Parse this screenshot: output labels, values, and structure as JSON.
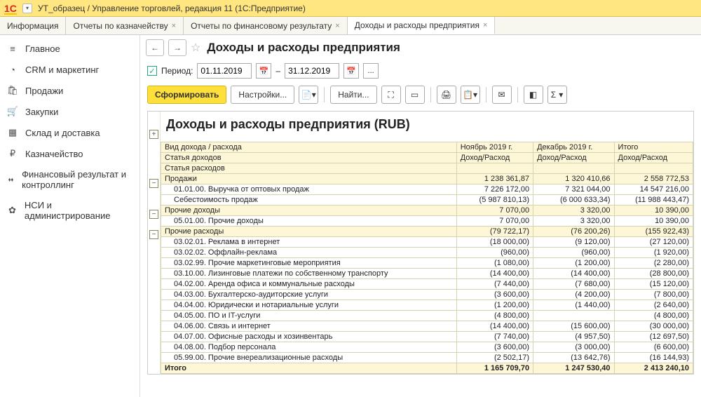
{
  "window": {
    "title": "УТ_образец / Управление торговлей, редакция 11  (1С:Предприятие)"
  },
  "tabs": [
    {
      "label": "Информация",
      "closable": false
    },
    {
      "label": "Отчеты по казначейству",
      "closable": true
    },
    {
      "label": "Отчеты по финансовому результату",
      "closable": true
    },
    {
      "label": "Доходы и расходы предприятия",
      "closable": true,
      "active": true
    }
  ],
  "sidebar": [
    {
      "icon": "≡",
      "label": "Главное"
    },
    {
      "icon": "◔",
      "label": "CRM и маркетинг"
    },
    {
      "icon": "🛍",
      "label": "Продажи"
    },
    {
      "icon": "🛒",
      "label": "Закупки"
    },
    {
      "icon": "▦",
      "label": "Склад и доставка"
    },
    {
      "icon": "₽",
      "label": "Казначейство"
    },
    {
      "icon": "⬪⬪",
      "label": "Финансовый результат и контроллинг"
    },
    {
      "icon": "✿",
      "label": "НСИ и администрирование"
    }
  ],
  "page": {
    "title": "Доходы и расходы предприятия"
  },
  "period": {
    "label": "Период:",
    "from": "01.11.2019",
    "to": "31.12.2019",
    "sep": "–"
  },
  "buttons": {
    "form": "Сформировать",
    "settings": "Настройки...",
    "find": "Найти..."
  },
  "report": {
    "title": "Доходы и расходы предприятия (RUB)",
    "headers": {
      "c0": "Вид дохода / расхода",
      "c0a": "Статья доходов",
      "c0b": "Статья расходов",
      "c1": "Ноябрь 2019 г.",
      "c2": "Декабрь 2019 г.",
      "c3": "Итого",
      "sub": "Доход/Расход"
    },
    "rows": [
      {
        "t": "g",
        "indent": 0,
        "label": "Продажи",
        "v": [
          "1 238 361,87",
          "1 320 410,66",
          "2 558 772,53"
        ]
      },
      {
        "t": "d",
        "indent": 1,
        "label": "01.01.00. Выручка от оптовых продаж",
        "v": [
          "7 226 172,00",
          "7 321 044,00",
          "14 547 216,00"
        ]
      },
      {
        "t": "d",
        "indent": 1,
        "label": "Себестоимость продаж",
        "v": [
          "(5 987 810,13)",
          "(6 000 633,34)",
          "(11 988 443,47)"
        ]
      },
      {
        "t": "g",
        "indent": 0,
        "label": "Прочие доходы",
        "v": [
          "7 070,00",
          "3 320,00",
          "10 390,00"
        ]
      },
      {
        "t": "d",
        "indent": 1,
        "label": "05.01.00. Прочие доходы",
        "v": [
          "7 070,00",
          "3 320,00",
          "10 390,00"
        ]
      },
      {
        "t": "g",
        "indent": 0,
        "label": "Прочие расходы",
        "v": [
          "(79 722,17)",
          "(76 200,26)",
          "(155 922,43)"
        ]
      },
      {
        "t": "d",
        "indent": 1,
        "label": "03.02.01. Реклама в интернет",
        "v": [
          "(18 000,00)",
          "(9 120,00)",
          "(27 120,00)"
        ]
      },
      {
        "t": "d",
        "indent": 1,
        "label": "03.02.02. Оффлайн-реклама",
        "v": [
          "(960,00)",
          "(960,00)",
          "(1 920,00)"
        ]
      },
      {
        "t": "d",
        "indent": 1,
        "label": "03.02.99. Прочие маркетинговые мероприятия",
        "v": [
          "(1 080,00)",
          "(1 200,00)",
          "(2 280,00)"
        ]
      },
      {
        "t": "d",
        "indent": 1,
        "label": "03.10.00. Лизинговые платежи по собственному транспорту",
        "v": [
          "(14 400,00)",
          "(14 400,00)",
          "(28 800,00)"
        ]
      },
      {
        "t": "d",
        "indent": 1,
        "label": "04.02.00. Аренда офиса и коммунальные расходы",
        "v": [
          "(7 440,00)",
          "(7 680,00)",
          "(15 120,00)"
        ]
      },
      {
        "t": "d",
        "indent": 1,
        "label": "04.03.00. Бухгалтерско-аудиторские услуги",
        "v": [
          "(3 600,00)",
          "(4 200,00)",
          "(7 800,00)"
        ]
      },
      {
        "t": "d",
        "indent": 1,
        "label": "04.04.00. Юридически и нотариальные услуги",
        "v": [
          "(1 200,00)",
          "(1 440,00)",
          "(2 640,00)"
        ]
      },
      {
        "t": "d",
        "indent": 1,
        "label": "04.05.00. ПО и IT-услуги",
        "v": [
          "(4 800,00)",
          "",
          "(4 800,00)"
        ]
      },
      {
        "t": "d",
        "indent": 1,
        "label": "04.06.00. Связь и интернет",
        "v": [
          "(14 400,00)",
          "(15 600,00)",
          "(30 000,00)"
        ]
      },
      {
        "t": "d",
        "indent": 1,
        "label": "04.07.00. Офисные расходы и хозинвентарь",
        "v": [
          "(7 740,00)",
          "(4 957,50)",
          "(12 697,50)"
        ]
      },
      {
        "t": "d",
        "indent": 1,
        "label": "04.08.00. Подбор персонала",
        "v": [
          "(3 600,00)",
          "(3 000,00)",
          "(6 600,00)"
        ]
      },
      {
        "t": "d",
        "indent": 1,
        "label": "05.99.00. Прочие внереализационные расходы",
        "v": [
          "(2 502,17)",
          "(13 642,76)",
          "(16 144,93)"
        ]
      },
      {
        "t": "t",
        "indent": 0,
        "label": "Итого",
        "v": [
          "1 165 709,70",
          "1 247 530,40",
          "2 413 240,10"
        ]
      }
    ]
  },
  "icons": {
    "sigma": "Σ",
    "dots": "..."
  }
}
